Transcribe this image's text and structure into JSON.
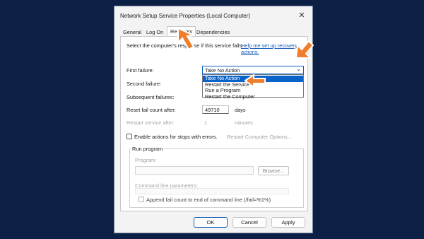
{
  "window": {
    "title": "Network Setup Service Properties (Local Computer)",
    "close_glyph": "✕"
  },
  "tabs": [
    {
      "label": "General"
    },
    {
      "label": "Log On"
    },
    {
      "label": "Recovery",
      "active": true
    },
    {
      "label": "Dependencies"
    }
  ],
  "recovery": {
    "intro_text": "Select the computer's response if this service fails.",
    "help_link": "Help me set up recovery actions.",
    "first_failure_label": "First failure:",
    "first_failure_value": "Take No Action",
    "second_failure_label": "Second failure:",
    "subsequent_failures_label": "Subsequent failures:",
    "dropdown_options": [
      "Take No Action",
      "Restart the Service",
      "Run a Program",
      "Restart the Computer"
    ],
    "dropdown_highlighted": "Take No Action",
    "reset_label": "Reset fail count after:",
    "reset_value": "49710",
    "reset_unit": "days",
    "restart_label": "Restart service after:",
    "restart_value": "1",
    "restart_unit": "minutes",
    "stops_checkbox_label": "Enable actions for stops with errors.",
    "restart_computer_options": "Restart Computer Options...",
    "run_program": {
      "group_label": "Run program",
      "program_label": "Program:",
      "browse_label": "Browse...",
      "params_label": "Command line parameters:",
      "append_label": "Append fail count to end of command line (/fail=%1%)"
    }
  },
  "footer": {
    "ok": "OK",
    "cancel": "Cancel",
    "apply": "Apply"
  },
  "colors": {
    "background": "#0c1f44",
    "accent": "#0a63c9",
    "arrow": "#ee7d2c"
  }
}
